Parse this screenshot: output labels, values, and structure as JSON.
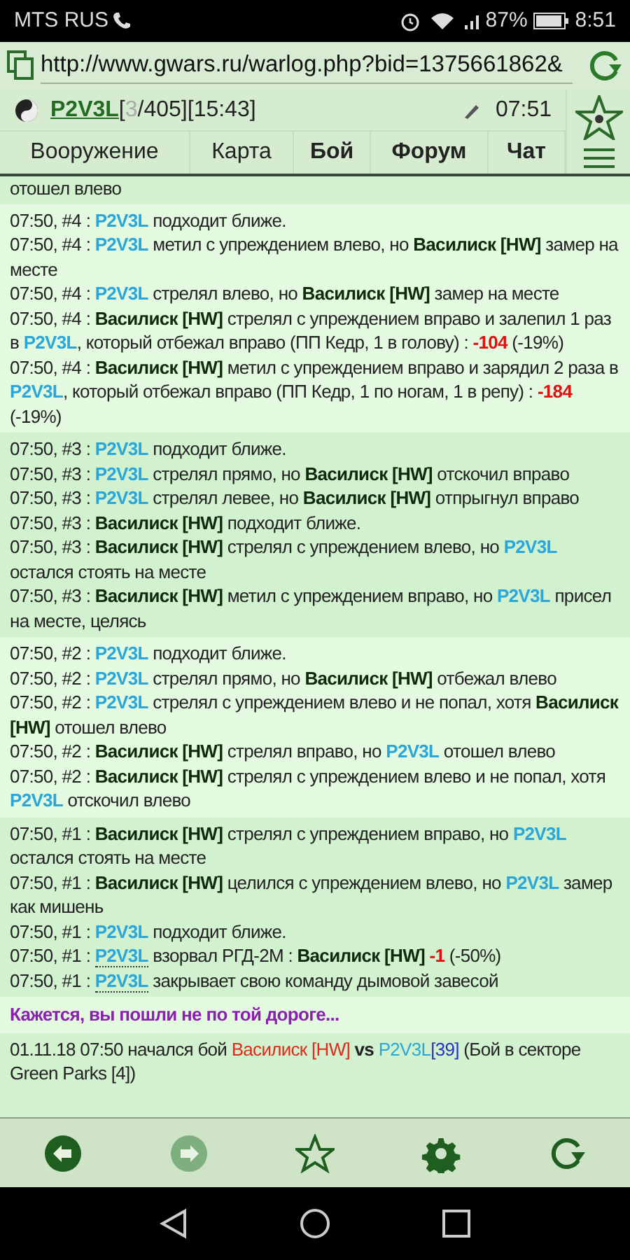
{
  "status_bar": {
    "carrier": "MTS RUS",
    "battery": "87%",
    "time": "8:51"
  },
  "address_bar": {
    "url": "http://www.gwars.ru/warlog.php?bid=1375661862&"
  },
  "header": {
    "player": "P2V3L",
    "stats": [
      {
        "kind": "plain",
        "text": " ["
      },
      {
        "kind": "muted",
        "text": "3"
      },
      {
        "kind": "plain",
        "text": "/405][15:43]"
      }
    ],
    "time": "07:51"
  },
  "tabs": [
    {
      "label": "Вооружение",
      "bold": false
    },
    {
      "label": "Карта",
      "bold": false
    },
    {
      "label": "Бой",
      "bold": true
    },
    {
      "label": "Форум",
      "bold": true
    },
    {
      "label": "Чат",
      "bold": true
    }
  ],
  "log_blocks": [
    {
      "lines": [
        [
          {
            "kind": "plain",
            "text": "отошел влево"
          }
        ]
      ]
    },
    {
      "lines": [
        [
          {
            "kind": "plain",
            "text": "07:50, #4 : "
          },
          {
            "kind": "player",
            "text": "P2V3L"
          },
          {
            "kind": "plain",
            "text": " подходит ближе."
          }
        ],
        [
          {
            "kind": "plain",
            "text": "07:50, #4 : "
          },
          {
            "kind": "player",
            "text": "P2V3L"
          },
          {
            "kind": "plain",
            "text": " метил с упреждением влево, но "
          },
          {
            "kind": "enemy",
            "text": "Василиск [HW]"
          },
          {
            "kind": "plain",
            "text": " замер на месте"
          }
        ],
        [
          {
            "kind": "plain",
            "text": "07:50, #4 : "
          },
          {
            "kind": "player",
            "text": "P2V3L"
          },
          {
            "kind": "plain",
            "text": " стрелял влево, но "
          },
          {
            "kind": "enemy",
            "text": "Василиск [HW]"
          },
          {
            "kind": "plain",
            "text": " замер на месте"
          }
        ],
        [
          {
            "kind": "plain",
            "text": "07:50, #4 : "
          },
          {
            "kind": "enemy",
            "text": "Василиск [HW]"
          },
          {
            "kind": "plain",
            "text": " стрелял с упреждением вправо и залепил 1 раз в "
          },
          {
            "kind": "player",
            "text": "P2V3L"
          },
          {
            "kind": "plain",
            "text": ", который отбежал вправо (ПП Кедр, 1 в голову) : "
          },
          {
            "kind": "damage",
            "text": "-104"
          },
          {
            "kind": "plain",
            "text": " (-19%)"
          }
        ],
        [
          {
            "kind": "plain",
            "text": "07:50, #4 : "
          },
          {
            "kind": "enemy",
            "text": "Василиск [HW]"
          },
          {
            "kind": "plain",
            "text": " метил с упреждением вправо и зарядил 2 раза в "
          },
          {
            "kind": "player",
            "text": "P2V3L"
          },
          {
            "kind": "plain",
            "text": ", который отбежал вправо (ПП Кедр, 1 по ногам, 1 в репу) : "
          },
          {
            "kind": "damage",
            "text": "-184"
          },
          {
            "kind": "plain",
            "text": " (-19%)"
          }
        ]
      ]
    },
    {
      "lines": [
        [
          {
            "kind": "plain",
            "text": "07:50, #3 : "
          },
          {
            "kind": "player",
            "text": "P2V3L"
          },
          {
            "kind": "plain",
            "text": " подходит ближе."
          }
        ],
        [
          {
            "kind": "plain",
            "text": "07:50, #3 : "
          },
          {
            "kind": "player",
            "text": "P2V3L"
          },
          {
            "kind": "plain",
            "text": " стрелял прямо, но "
          },
          {
            "kind": "enemy",
            "text": "Василиск [HW]"
          },
          {
            "kind": "plain",
            "text": " отскочил вправо"
          }
        ],
        [
          {
            "kind": "plain",
            "text": "07:50, #3 : "
          },
          {
            "kind": "player",
            "text": "P2V3L"
          },
          {
            "kind": "plain",
            "text": " стрелял левее, но "
          },
          {
            "kind": "enemy",
            "text": "Василиск [HW]"
          },
          {
            "kind": "plain",
            "text": " отпрыгнул вправо"
          }
        ],
        [
          {
            "kind": "plain",
            "text": "07:50, #3 : "
          },
          {
            "kind": "enemy",
            "text": "Василиск [HW]"
          },
          {
            "kind": "plain",
            "text": " подходит ближе."
          }
        ],
        [
          {
            "kind": "plain",
            "text": "07:50, #3 : "
          },
          {
            "kind": "enemy",
            "text": "Василиск [HW]"
          },
          {
            "kind": "plain",
            "text": " стрелял с упреждением влево, но "
          },
          {
            "kind": "player",
            "text": "P2V3L"
          },
          {
            "kind": "plain",
            "text": " остался стоять на месте"
          }
        ],
        [
          {
            "kind": "plain",
            "text": "07:50, #3 : "
          },
          {
            "kind": "enemy",
            "text": "Василиск [HW]"
          },
          {
            "kind": "plain",
            "text": " метил с упреждением вправо, но "
          },
          {
            "kind": "player",
            "text": "P2V3L"
          },
          {
            "kind": "plain",
            "text": " присел на месте, целясь"
          }
        ]
      ]
    },
    {
      "lines": [
        [
          {
            "kind": "plain",
            "text": "07:50, #2 : "
          },
          {
            "kind": "player",
            "text": "P2V3L"
          },
          {
            "kind": "plain",
            "text": " подходит ближе."
          }
        ],
        [
          {
            "kind": "plain",
            "text": "07:50, #2 : "
          },
          {
            "kind": "player",
            "text": "P2V3L"
          },
          {
            "kind": "plain",
            "text": " стрелял прямо, но "
          },
          {
            "kind": "enemy",
            "text": "Василиск [HW]"
          },
          {
            "kind": "plain",
            "text": " отбежал влево"
          }
        ],
        [
          {
            "kind": "plain",
            "text": "07:50, #2 : "
          },
          {
            "kind": "player",
            "text": "P2V3L"
          },
          {
            "kind": "plain",
            "text": " стрелял с упреждением влево и не попал, хотя "
          },
          {
            "kind": "enemy",
            "text": "Василиск [HW]"
          },
          {
            "kind": "plain",
            "text": " отошел влево"
          }
        ],
        [
          {
            "kind": "plain",
            "text": "07:50, #2 : "
          },
          {
            "kind": "enemy",
            "text": "Василиск [HW]"
          },
          {
            "kind": "plain",
            "text": " стрелял вправо, но "
          },
          {
            "kind": "player",
            "text": "P2V3L"
          },
          {
            "kind": "plain",
            "text": " отошел влево"
          }
        ],
        [
          {
            "kind": "plain",
            "text": "07:50, #2 : "
          },
          {
            "kind": "enemy",
            "text": "Василиск [HW]"
          },
          {
            "kind": "plain",
            "text": " стрелял с упреждением влево и не попал, хотя "
          },
          {
            "kind": "player",
            "text": "P2V3L"
          },
          {
            "kind": "plain",
            "text": " отскочил влево"
          }
        ]
      ]
    },
    {
      "lines": [
        [
          {
            "kind": "plain",
            "text": "07:50, #1 : "
          },
          {
            "kind": "enemy",
            "text": "Василиск [HW]"
          },
          {
            "kind": "plain",
            "text": " стрелял с упреждением вправо, но "
          },
          {
            "kind": "player",
            "text": "P2V3L"
          },
          {
            "kind": "plain",
            "text": " остался стоять на месте"
          }
        ],
        [
          {
            "kind": "plain",
            "text": "07:50, #1 : "
          },
          {
            "kind": "enemy",
            "text": "Василиск [HW]"
          },
          {
            "kind": "plain",
            "text": " целился с упреждением влево, но "
          },
          {
            "kind": "player",
            "text": "P2V3L"
          },
          {
            "kind": "plain",
            "text": " замер как мишень"
          }
        ],
        [
          {
            "kind": "plain",
            "text": "07:50, #1 : "
          },
          {
            "kind": "player",
            "text": "P2V3L"
          },
          {
            "kind": "plain",
            "text": " подходит ближе."
          }
        ],
        [
          {
            "kind": "plain",
            "text": "07:50, #1 : "
          },
          {
            "kind": "player_dotted",
            "text": "P2V3L"
          },
          {
            "kind": "plain",
            "text": " взорвал РГД-2М : "
          },
          {
            "kind": "enemy",
            "text": "Василиск [HW]"
          },
          {
            "kind": "damage",
            "text": " -1"
          },
          {
            "kind": "plain",
            "text": " (-50%)"
          }
        ],
        [
          {
            "kind": "plain",
            "text": "07:50, #1 : "
          },
          {
            "kind": "player_dotted",
            "text": "P2V3L"
          },
          {
            "kind": "plain",
            "text": " закрывает свою команду дымовой завесой"
          }
        ]
      ]
    }
  ],
  "notice": "Кажется, вы пошли не по той дороге...",
  "summary": [
    {
      "kind": "plain",
      "text": "01.11.18 07:50 начался бой "
    },
    {
      "kind": "red",
      "text": "Василиск [HW]"
    },
    {
      "kind": "bold",
      "text": " vs "
    },
    {
      "kind": "cyan",
      "text": "P2V3L"
    },
    {
      "kind": "level",
      "text": "[39]"
    },
    {
      "kind": "plain",
      "text": " (Бой в секторе Green Parks [4])"
    }
  ],
  "bottom_nav": [
    {
      "kind": "back",
      "disabled": false
    },
    {
      "kind": "forward",
      "disabled": true
    },
    {
      "kind": "star",
      "disabled": false
    },
    {
      "kind": "settings",
      "disabled": false
    },
    {
      "kind": "refresh",
      "disabled": false
    }
  ]
}
